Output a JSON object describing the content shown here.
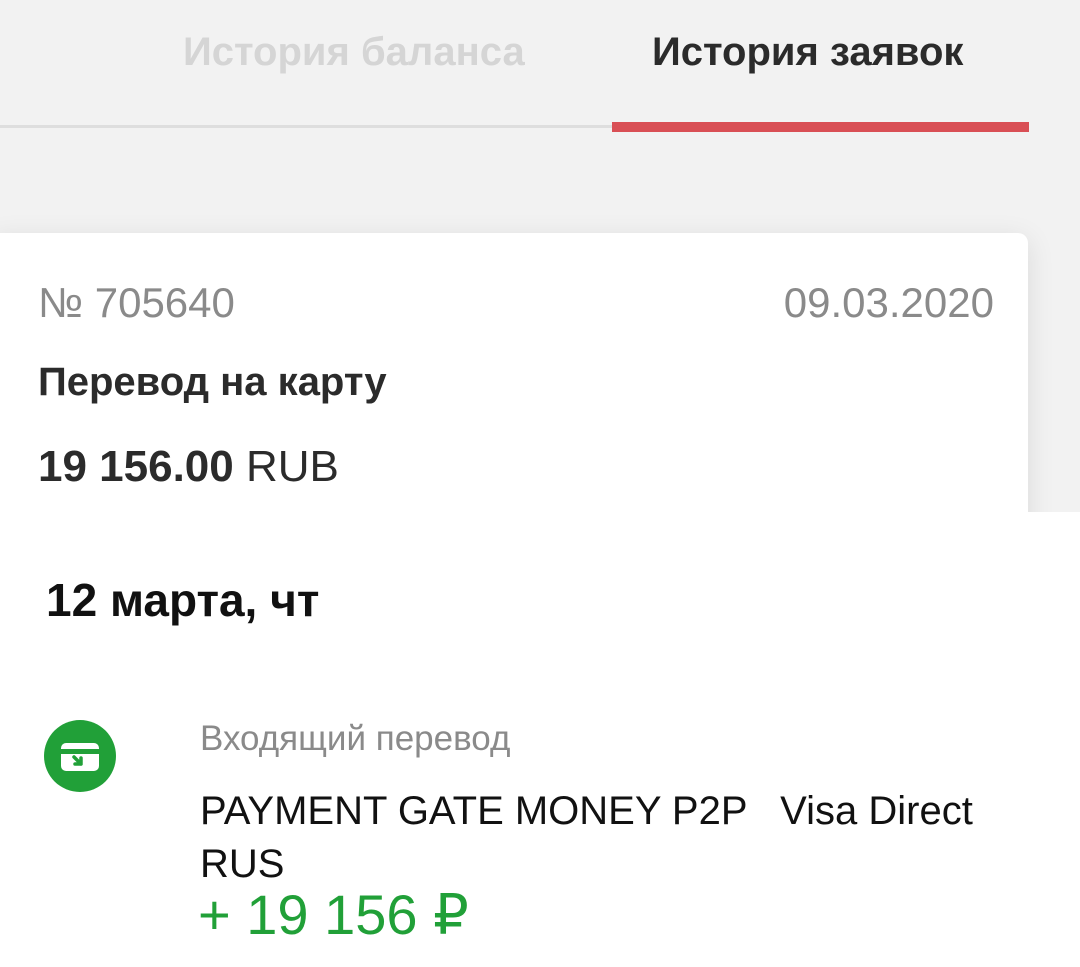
{
  "tabs": {
    "balance_history": "История баланса",
    "request_history": "История заявок",
    "active": "request_history"
  },
  "request": {
    "number": "№ 705640",
    "date": "09.03.2020",
    "title": "Перевод на карту",
    "amount": "19 156.00",
    "currency": "RUB"
  },
  "transaction_day": {
    "header": "12 марта, чт"
  },
  "transaction": {
    "icon": "incoming-card-icon",
    "type": "Входящий перевод",
    "description": "PAYMENT GATE MONEY P2P   Visa Direct RUS",
    "amount": "+ 19 156 ₽"
  },
  "colors": {
    "accent_red": "#d94f55",
    "income_green": "#21a038",
    "inactive_tab": "#d5d5d5",
    "text_dark": "#2b2b2b",
    "text_muted": "#8a8a8a",
    "panel_background": "#f2f2f2"
  }
}
